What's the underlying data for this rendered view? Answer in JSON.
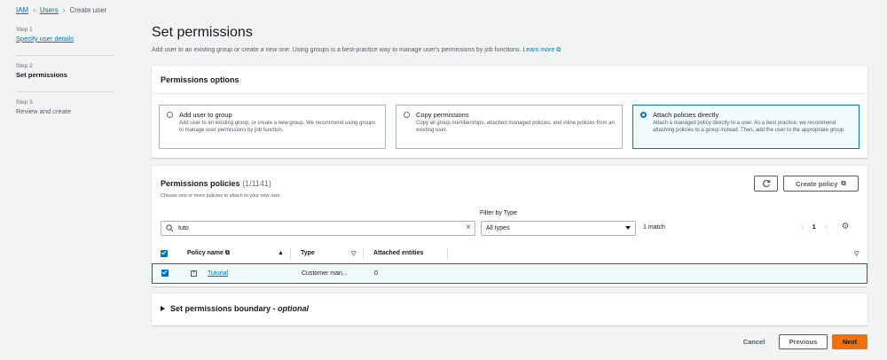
{
  "breadcrumb": {
    "item1": "IAM",
    "item2": "Users",
    "current": "Create user"
  },
  "steps": [
    {
      "num": "Step 1",
      "label": "Specify user details"
    },
    {
      "num": "Step 2",
      "label": "Set permissions"
    },
    {
      "num": "Step 3",
      "label": "Review and create"
    }
  ],
  "page": {
    "title": "Set permissions",
    "description": "Add user to an existing group or create a new one. Using groups is a best-practice way to manage user's permissions by job functions.",
    "learn_more": "Learn more"
  },
  "options": {
    "title": "Permissions options",
    "cards": [
      {
        "title": "Add user to group",
        "desc": "Add user to an existing group, or create a new group. We recommend using groups to manage user permissions by job function."
      },
      {
        "title": "Copy permissions",
        "desc": "Copy all group memberships, attached managed policies, and inline policies from an existing user."
      },
      {
        "title": "Attach policies directly",
        "desc": "Attach a managed policy directly to a user. As a best practice, we recommend attaching policies to a group instead. Then, add the user to the appropriate group."
      }
    ],
    "selected": 2
  },
  "policies": {
    "title": "Permissions policies",
    "count": "(1/1141)",
    "subtitle": "Choose one or more policies to attach to your new user.",
    "refresh_icon": "refresh-icon",
    "create_label": "Create policy",
    "filter_label": "Filter by Type",
    "search_value": "tuto",
    "filter_value": "All types",
    "match_text": "1 match",
    "page": "1",
    "columns": {
      "name": "Policy name",
      "type": "Type",
      "attached": "Attached entities"
    },
    "rows": [
      {
        "name": "Tutorial",
        "type": "Customer man...",
        "attached": "0",
        "checked": true
      }
    ]
  },
  "boundary": {
    "label": "Set permissions boundary - ",
    "optional": "optional"
  },
  "footer": {
    "cancel": "Cancel",
    "previous": "Previous",
    "next": "Next"
  },
  "colors": {
    "accent": "#0073bb",
    "primary_button": "#ec7211"
  }
}
